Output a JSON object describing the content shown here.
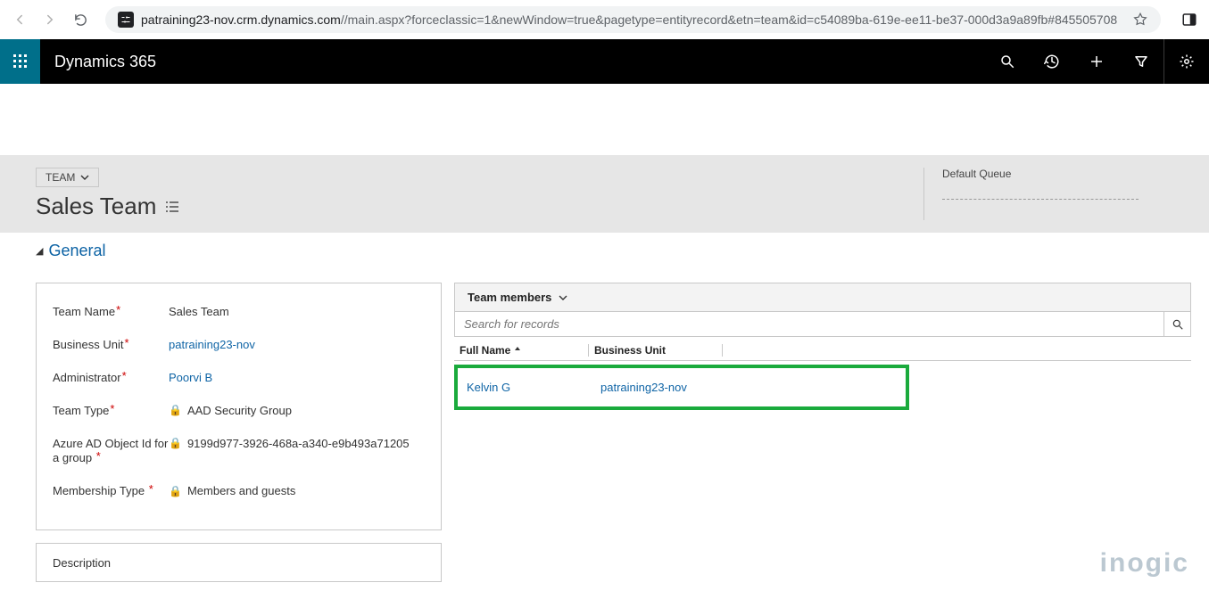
{
  "browser": {
    "url_host": "patraining23-nov.crm.dynamics.com",
    "url_path": "//main.aspx?forceclassic=1&newWindow=true&pagetype=entityrecord&etn=team&id=c54089ba-619e-ee11-be37-000d3a9a89fb#845505708"
  },
  "topbar": {
    "brand": "Dynamics 365"
  },
  "header": {
    "entity_label": "TEAM",
    "record_title": "Sales Team",
    "right_label": "Default Queue"
  },
  "section": {
    "title": "General"
  },
  "fields": {
    "team_name": {
      "label": "Team Name",
      "value": "Sales Team"
    },
    "business_unit": {
      "label": "Business Unit",
      "value": "patraining23-nov"
    },
    "administrator": {
      "label": "Administrator",
      "value": "Poorvi B"
    },
    "team_type": {
      "label": "Team Type",
      "value": "AAD Security Group"
    },
    "aad_object": {
      "label": "Azure AD Object Id for a group",
      "value": "9199d977-3926-468a-a340-e9b493a71205"
    },
    "membership": {
      "label": "Membership Type",
      "value": "Members and guests"
    },
    "description": {
      "label": "Description"
    }
  },
  "members": {
    "title": "Team members",
    "search_placeholder": "Search for records",
    "columns": {
      "full_name": "Full Name",
      "business_unit": "Business Unit"
    },
    "rows": [
      {
        "full_name": "Kelvin G",
        "business_unit": "patraining23-nov"
      }
    ]
  },
  "watermark": "inogic"
}
